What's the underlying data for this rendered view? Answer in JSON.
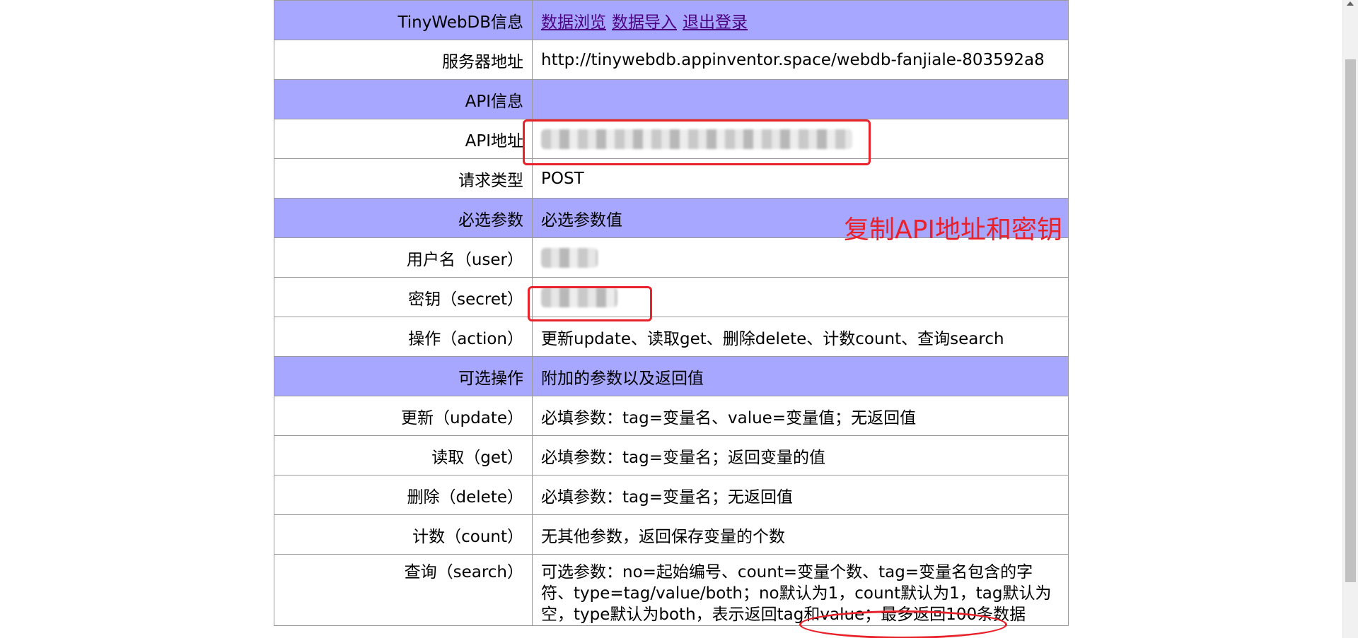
{
  "table": {
    "rows": [
      {
        "label": "TinyWebDB信息",
        "value": "",
        "highlight": true
      },
      {
        "label": "服务器地址",
        "value": "http://tinywebdb.appinventor.space/webdb-fanjiale-803592a8"
      },
      {
        "label": "API信息",
        "value": "",
        "highlight": true
      },
      {
        "label": "API地址",
        "value": ""
      },
      {
        "label": "请求类型",
        "value": "POST"
      },
      {
        "label": "必选参数",
        "value": "必选参数值",
        "highlight": true
      },
      {
        "label": "用户名（user）",
        "value": ""
      },
      {
        "label": "密钥（secret）",
        "value": ""
      },
      {
        "label": "操作（action）",
        "value": "更新update、读取get、删除delete、计数count、查询search"
      },
      {
        "label": "可选操作",
        "value": "附加的参数以及返回值",
        "highlight": true
      },
      {
        "label": "更新（update）",
        "value": "必填参数：tag=变量名、value=变量值；无返回值"
      },
      {
        "label": "读取（get）",
        "value": "必填参数：tag=变量名；返回变量的值"
      },
      {
        "label": "删除（delete）",
        "value": "必填参数：tag=变量名；无返回值"
      },
      {
        "label": "计数（count）",
        "value": "无其他参数，返回保存变量的个数"
      },
      {
        "label": "查询（search）",
        "value": "可选参数：no=起始编号、count=变量个数、tag=变量名包含的字符、type=tag/value/both；no默认为1，count默认为1，tag默认为空，type默认为both，表示返回tag和value；最多返回100条数据"
      }
    ]
  },
  "nav_links": [
    "数据浏览",
    "数据导入",
    "退出登录"
  ],
  "annotation": {
    "text": "复制API地址和密钥",
    "color": "#e8212a"
  },
  "colors": {
    "highlight_row": "#a7a7ff",
    "border": "#9a9a9a",
    "link": "#4b0082"
  }
}
